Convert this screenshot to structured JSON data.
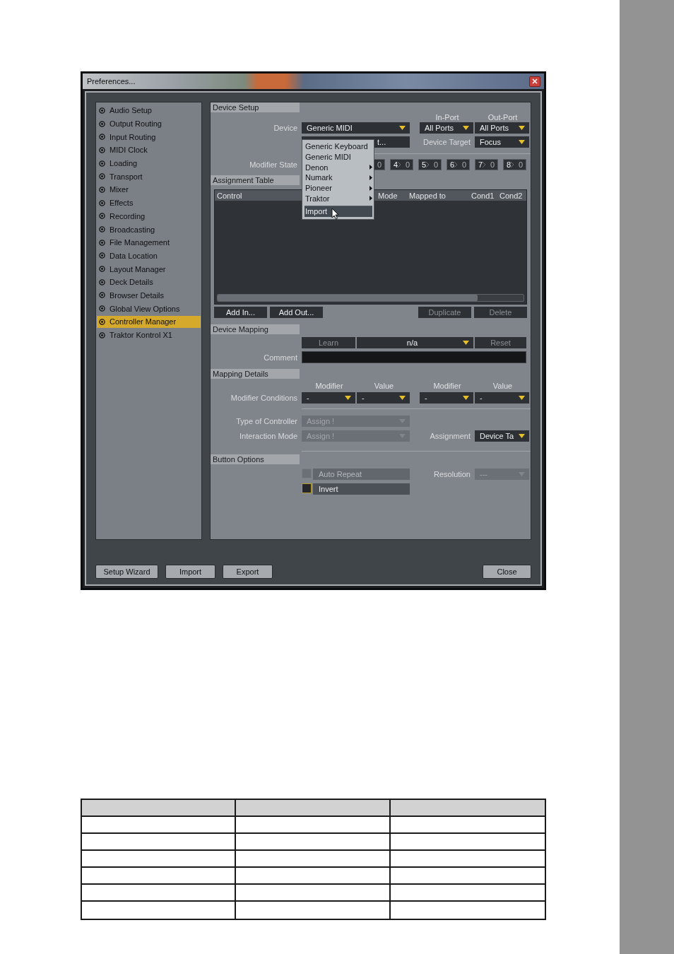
{
  "window": {
    "title": "Preferences..."
  },
  "sidebar": {
    "items": [
      {
        "label": "Audio Setup",
        "selected": false
      },
      {
        "label": "Output Routing",
        "selected": false
      },
      {
        "label": "Input Routing",
        "selected": false
      },
      {
        "label": "MIDI Clock",
        "selected": false
      },
      {
        "label": "Loading",
        "selected": false
      },
      {
        "label": "Transport",
        "selected": false
      },
      {
        "label": "Mixer",
        "selected": false
      },
      {
        "label": "Effects",
        "selected": false
      },
      {
        "label": "Recording",
        "selected": false
      },
      {
        "label": "Broadcasting",
        "selected": false
      },
      {
        "label": "File Management",
        "selected": false
      },
      {
        "label": "Data Location",
        "selected": false
      },
      {
        "label": "Layout Manager",
        "selected": false
      },
      {
        "label": "Deck Details",
        "selected": false
      },
      {
        "label": "Browser Details",
        "selected": false
      },
      {
        "label": "Global View Options",
        "selected": false
      },
      {
        "label": "Controller Manager",
        "selected": true
      },
      {
        "label": "Traktor Kontrol X1",
        "selected": false
      }
    ]
  },
  "device_setup": {
    "title": "Device Setup",
    "in_port_header": "In-Port",
    "out_port_header": "Out-Port",
    "device_label": "Device",
    "device": "Generic MIDI",
    "in_port": "All Ports",
    "out_port": "All Ports",
    "field_2": "t...",
    "device_target_label": "Device Target",
    "device_target": "Focus",
    "modifier_state_label": "Modifier State",
    "modifier_states": [
      {
        "value": "0"
      },
      {
        "number": "4",
        "value": "0"
      },
      {
        "number": "5",
        "value": "0"
      },
      {
        "number": "6",
        "value": "0"
      },
      {
        "number": "7",
        "value": "0"
      },
      {
        "number": "8",
        "value": "0"
      }
    ]
  },
  "device_menu": {
    "items": [
      {
        "label": "Generic Keyboard",
        "submenu": false,
        "selected": false
      },
      {
        "label": "Generic MIDI",
        "submenu": false,
        "selected": false
      },
      {
        "label": "Denon",
        "submenu": true,
        "selected": false
      },
      {
        "label": "Numark",
        "submenu": true,
        "selected": false
      },
      {
        "label": "Pioneer",
        "submenu": true,
        "selected": false
      },
      {
        "label": "Traktor",
        "submenu": true,
        "selected": false
      },
      {
        "label": "Import",
        "submenu": false,
        "selected": true,
        "separator_before": true
      }
    ]
  },
  "assignment_table": {
    "title": "Assignment Table",
    "columns": [
      "Control",
      "Mode",
      "Mapped to",
      "Cond1",
      "Cond2"
    ],
    "buttons": [
      {
        "label": "Add In...",
        "disabled": false
      },
      {
        "label": "Add Out...",
        "disabled": false
      },
      {
        "label": "Duplicate",
        "disabled": true
      },
      {
        "label": "Delete",
        "disabled": true
      }
    ]
  },
  "device_mapping": {
    "title": "Device Mapping",
    "learn": {
      "label": "Learn",
      "disabled": true
    },
    "mapping": "n/a",
    "reset": {
      "label": "Reset",
      "disabled": true
    },
    "comment_label": "Comment"
  },
  "mapping_details": {
    "title": "Mapping Details",
    "condition_headers": [
      "Modifier",
      "Value",
      "Modifier",
      "Value"
    ],
    "conditions_label": "Modifier Conditions",
    "conditions": [
      "-",
      "-",
      "-",
      "-"
    ],
    "type_label": "Type of Controller",
    "type": {
      "value": "Assign !",
      "disabled": true
    },
    "interaction_label": "Interaction Mode",
    "interaction": {
      "value": "Assign !",
      "disabled": true
    },
    "assignment_label": "Assignment",
    "assignment": {
      "value": "Device Ta",
      "disabled": false
    }
  },
  "button_options": {
    "title": "Button Options",
    "options": [
      {
        "label": "Auto Repeat",
        "checked": false,
        "disabled": true
      },
      {
        "label": "Invert",
        "checked": false,
        "disabled": false
      }
    ],
    "resolution_label": "Resolution",
    "resolution": {
      "value": "---",
      "disabled": true
    }
  },
  "footer_buttons": [
    "Setup Wizard",
    "Import",
    "Export"
  ],
  "close_button": "Close"
}
